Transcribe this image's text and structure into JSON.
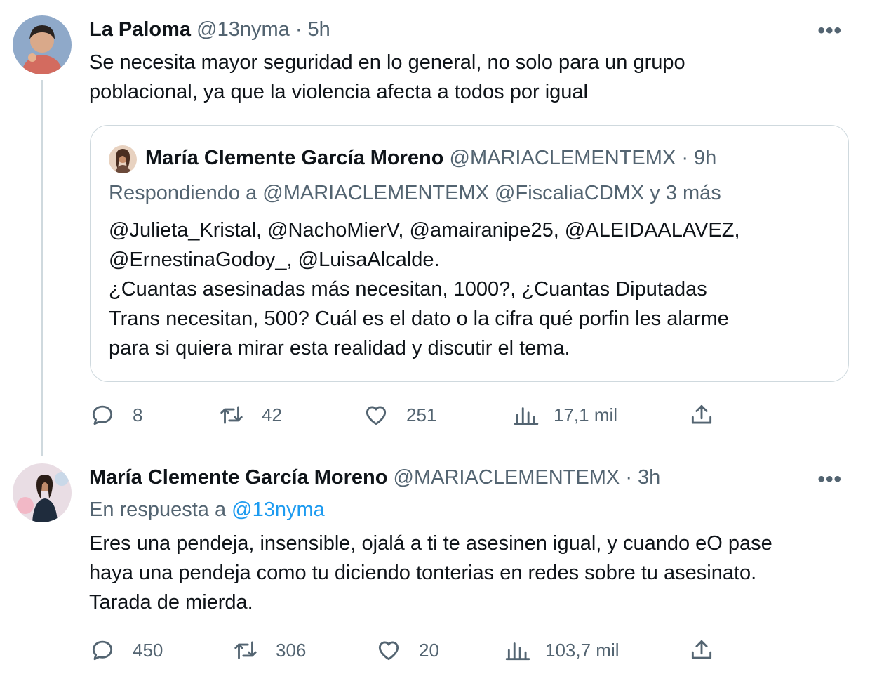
{
  "tweet1": {
    "name": "La Paloma",
    "handle": "@13nyma",
    "sep": "·",
    "time": "5h",
    "more": "•••",
    "text_lines": [
      "Se necesita mayor seguridad en lo general, no solo para un grupo",
      "poblacional, ya que la violencia afecta a todos por igual"
    ],
    "quote": {
      "name": "María Clemente García Moreno",
      "handle": "@MARIACLEMENTEMX",
      "sep": "·",
      "time": "9h",
      "replying": "Respondiendo a @MARIACLEMENTEMX @FiscaliaCDMX y 3 más",
      "text_lines": [
        "@Julieta_Kristal, @NachoMierV, @amairanipe25, @ALEIDAALAVEZ,",
        "@ErnestinaGodoy_, @LuisaAlcalde.",
        "¿Cuantas asesinadas más necesitan, 1000?, ¿Cuantas Diputadas",
        "Trans necesitan, 500? Cuál es el dato o la cifra qué porfin les alarme",
        "para si quiera mirar esta realidad y discutir el tema."
      ]
    },
    "actions": {
      "replies": "8",
      "retweets": "42",
      "likes": "251",
      "views": "17,1 mil"
    }
  },
  "tweet2": {
    "name": "María Clemente García Moreno",
    "handle": "@MARIACLEMENTEMX",
    "sep": "·",
    "time": "3h",
    "more": "•••",
    "reply_prefix": "En respuesta a",
    "reply_handle": "@13nyma",
    "text_lines": [
      "Eres una pendeja, insensible, ojalá a ti te asesinen igual, y cuando eO pase",
      "haya una pendeja como tu diciendo tonterias en redes sobre tu asesinato.",
      "Tarada de mierda."
    ],
    "actions": {
      "replies": "450",
      "retweets": "306",
      "likes": "20",
      "views": "103,7 mil"
    }
  },
  "icons": {
    "reply": "reply-icon",
    "retweet": "retweet-icon",
    "like": "heart-icon",
    "views": "views-icon",
    "share": "share-icon",
    "more": "more-icon"
  },
  "colors": {
    "text": "#0f1419",
    "secondary": "#536471",
    "link": "#1d9bf0",
    "border": "#cfd9de"
  }
}
